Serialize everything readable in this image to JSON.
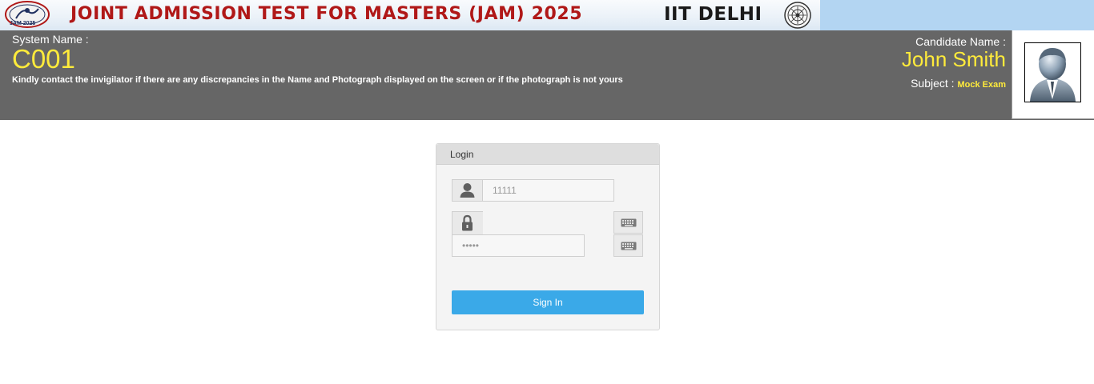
{
  "banner": {
    "logo_text": "JAM 2025",
    "title": "JOINT ADMISSION TEST FOR MASTERS (JAM) 2025",
    "institute": "IIT DELHI"
  },
  "header": {
    "system_name_label": "System Name :",
    "system_name_value": "C001",
    "notice": "Kindly contact the invigilator if there are any discrepancies in the Name and Photograph displayed on the screen or if the photograph is not yours",
    "candidate_name_label": "Candidate Name :",
    "candidate_name_value": "John Smith",
    "subject_label": "Subject :",
    "subject_value": "Mock Exam"
  },
  "login": {
    "title": "Login",
    "username_value": "11111",
    "password_value": "•••••",
    "signin_label": "Sign In"
  },
  "icons": [
    "user-icon",
    "lock-icon",
    "keyboard-icon",
    "candidate-photo-icon",
    "jam-logo-icon",
    "iit-emblem-icon"
  ],
  "colors": {
    "header_bg": "#666666",
    "highlight_text": "#ffeb3b",
    "signin_button": "#3aa9e8",
    "banner_title": "#b01818"
  }
}
